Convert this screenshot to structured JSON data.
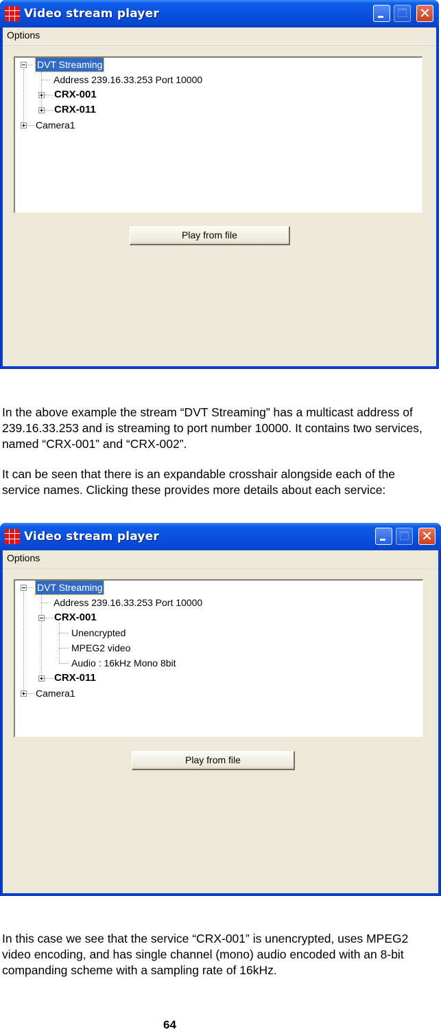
{
  "window1": {
    "title": "Video stream player",
    "icon": "grid-app-icon",
    "menu": [
      "Options"
    ],
    "tree": [
      {
        "label": "DVT Streaming",
        "state": "expanded",
        "selected": true,
        "bold": false
      },
      {
        "label": "Address 239.16.33.253  Port 10000",
        "state": "leaf",
        "bold": false
      },
      {
        "label": "CRX-001",
        "state": "collapsed",
        "bold": true
      },
      {
        "label": "CRX-011",
        "state": "collapsed",
        "bold": true
      },
      {
        "label": "Camera1",
        "state": "collapsed",
        "bold": false
      }
    ],
    "button_label": "Play from file"
  },
  "paragraph1": "In the above example the stream “DVT Streaming” has a multicast address of 239.16.33.253 and is streaming to port number 10000. It contains two services, named “CRX-001” and “CRX-002”.",
  "paragraph2": "It can be seen that there is an expandable crosshair alongside each of the service names. Clicking these provides more details about each service:",
  "window2": {
    "title": "Video stream player",
    "icon": "grid-app-icon",
    "menu": [
      "Options"
    ],
    "tree": [
      {
        "label": "DVT Streaming",
        "state": "expanded",
        "selected": true,
        "bold": false
      },
      {
        "label": "Address 239.16.33.253  Port 10000",
        "state": "leaf",
        "bold": false
      },
      {
        "label": "CRX-001",
        "state": "expanded",
        "bold": true
      },
      {
        "label": "Unencrypted",
        "state": "leaf",
        "bold": false
      },
      {
        "label": "MPEG2 video",
        "state": "leaf",
        "bold": false
      },
      {
        "label": "Audio : 16kHz Mono 8bit",
        "state": "leaf",
        "bold": false
      },
      {
        "label": "CRX-011",
        "state": "collapsed",
        "bold": true
      },
      {
        "label": "Camera1",
        "state": "collapsed",
        "bold": false
      }
    ],
    "button_label": "Play from file"
  },
  "paragraph3": "In this case we see that the service “CRX-001” is unencrypted, uses MPEG2 video encoding, and has single channel (mono) audio encoded with an 8-bit companding scheme with a sampling rate of 16kHz.",
  "page_number": "64",
  "colors": {
    "titlebar_blue": "#0a52e0",
    "client_bg": "#ece9d8",
    "selection_blue": "#316ac5",
    "close_red": "#c8401e"
  }
}
